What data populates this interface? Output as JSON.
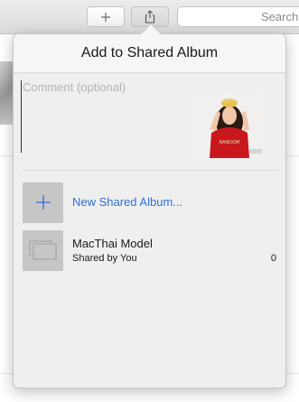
{
  "toolbar": {
    "add_icon": "plus-icon",
    "share_icon": "share-icon",
    "search": {
      "placeholder": "Search",
      "icon": "search-icon"
    }
  },
  "popover": {
    "title": "Add to Shared Album",
    "comment_placeholder": "Comment (optional)",
    "thumbnail": {
      "caption": "RANDOM",
      "colors": {
        "shirt": "#c8181e",
        "hair": "#2a1a12",
        "skin": "#f2c7a8"
      }
    },
    "new_album": {
      "label": "New Shared Album...",
      "icon": "plus-icon"
    },
    "albums": [
      {
        "name": "MacThai Model",
        "subtitle": "Shared by You",
        "count": "0",
        "icon": "photo-stack-icon"
      }
    ],
    "colors": {
      "link": "#2f6fd6",
      "icon_bg": "#c6c6c6",
      "background": "#efefef"
    }
  }
}
